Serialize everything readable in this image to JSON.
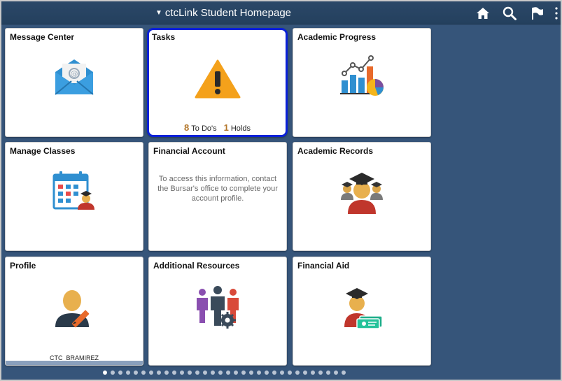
{
  "header": {
    "title": "ctcLink Student Homepage",
    "icons": [
      "home-icon",
      "search-icon",
      "flag-icon",
      "more-vertical-icon"
    ]
  },
  "tiles": {
    "message_center": {
      "title": "Message Center",
      "icon": "envelope-icon"
    },
    "tasks": {
      "title": "Tasks",
      "icon": "warning-icon",
      "todos_count": "8",
      "todos_label": "To Do's",
      "holds_count": "1",
      "holds_label": "Holds"
    },
    "academic_progress": {
      "title": "Academic Progress",
      "icon": "chart-icon"
    },
    "manage_classes": {
      "title": "Manage Classes",
      "icon": "calendar-student-icon"
    },
    "financial_account": {
      "title": "Financial Account",
      "message": "To access this information, contact the Bursar's office to complete your account profile."
    },
    "academic_records": {
      "title": "Academic Records",
      "icon": "graduates-icon"
    },
    "profile": {
      "title": "Profile",
      "icon": "profile-edit-icon",
      "username": "CTC_BRAMIREZ"
    },
    "additional_resources": {
      "title": "Additional Resources",
      "icon": "people-gear-icon"
    },
    "financial_aid": {
      "title": "Financial Aid",
      "icon": "graduate-money-icon"
    }
  },
  "pagination": {
    "total_pages": 32,
    "current_page": 1
  },
  "colors": {
    "header_bg": "#24405e",
    "page_bg": "#36557a",
    "selected_border": "#0a21d8",
    "count_color": "#b3762a"
  }
}
